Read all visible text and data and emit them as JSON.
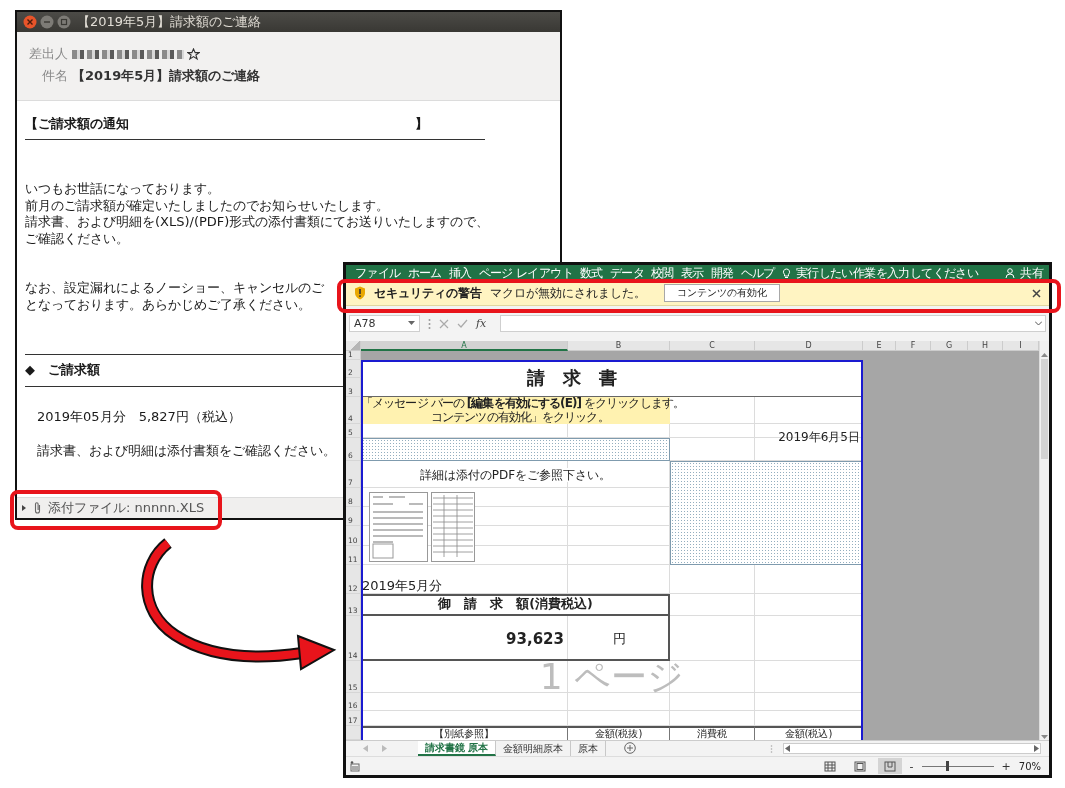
{
  "email_window": {
    "title": "【2019年5月】請求額のご連絡",
    "header": {
      "from_label": "差出人",
      "subject_label": "件名",
      "subject": "【2019年5月】請求額のご連絡"
    },
    "body": {
      "notice_heading": "【ご請求額の通知　　　　　　　　　　　　　　　　　　　　　　】",
      "paragraphs": [
        [
          "いつもお世話になっております。",
          "前月のご請求額が確定いたしましたのでお知らせいたします。",
          "請求書、および明細を(XLS)/(PDF)形式の添付書類にてお送りいたしますので、",
          "ご確認ください。"
        ],
        [
          "なお、設定漏れによるノーショー、キャンセルのご",
          "となっております。あらかじめご了承ください。"
        ]
      ],
      "section_heading": "◆　ご請求額",
      "amount_line": "2019年05月分　5,827円（税込）",
      "note": "請求書、および明細は添付書類をご確認ください。"
    },
    "attachment": {
      "label": "添付ファイル: nnnnn.XLS"
    }
  },
  "excel_window": {
    "ribbon_tabs": [
      "ファイル",
      "ホーム",
      "挿入",
      "ページ レイアウト",
      "数式",
      "データ",
      "校閲",
      "表示",
      "開発",
      "ヘルプ"
    ],
    "tell_me": "実行したい作業を入力してください",
    "share": "共有",
    "security_bar": {
      "title": "セキュリティの警告",
      "message": "マクロが無効にされました。",
      "button": "コンテンツの有効化"
    },
    "name_box": "A78",
    "function_button": "fx",
    "column_headers": [
      {
        "label": "A",
        "selected": true
      },
      {
        "label": "B",
        "selected": false
      },
      {
        "label": "C",
        "selected": false
      },
      {
        "label": "D",
        "selected": false
      },
      {
        "label": "E",
        "selected": false
      },
      {
        "label": "F",
        "selected": false
      },
      {
        "label": "G",
        "selected": false
      },
      {
        "label": "H",
        "selected": false
      },
      {
        "label": "I",
        "selected": false
      }
    ],
    "row_headers": [
      "1",
      "2",
      "3",
      "4",
      "5",
      "6",
      "7",
      "8",
      "9",
      "10",
      "11",
      "12",
      "13",
      "14",
      "15",
      "16",
      "17"
    ],
    "sheet": {
      "title": "請　求　書",
      "note": [
        "「メッセージ バーの **[編集を有効にする(E)]** をクリックします。",
        "コンテンツの有効化」をクリック。"
      ],
      "issue_date": "2019年6月5日",
      "pdf_note": "詳細は添付のPDFをご参照下さい。",
      "period": "2019年5月分",
      "amount_heading": "御　請　求　額(消費税込)",
      "amount": "93,623",
      "currency": "円",
      "page_label": "1 ページ",
      "table_headers": [
        "【別紙参照】",
        "金額(税抜)",
        "消費税",
        "金額(税込)"
      ]
    },
    "sheet_tabs": [
      {
        "label": "請求書鏡 原本",
        "selected": true
      },
      {
        "label": "金額明細原本",
        "selected": false
      },
      {
        "label": "原本",
        "selected": false
      }
    ],
    "status_bar": {
      "views": [
        {
          "kind": "normal",
          "selected": false
        },
        {
          "kind": "page-layout",
          "selected": false
        },
        {
          "kind": "page-break",
          "selected": true
        }
      ],
      "zoom_out": "-",
      "zoom_in": "+",
      "zoom": {
        "level": 0.35
      },
      "zoom_reading": "70%"
    }
  }
}
